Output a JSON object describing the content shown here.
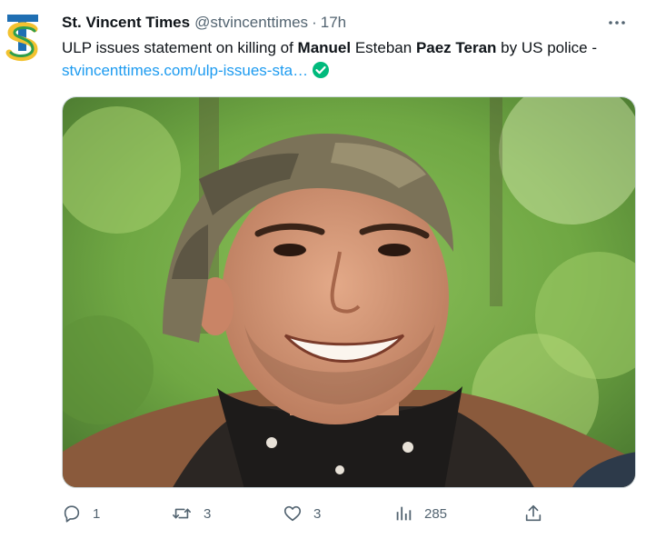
{
  "author": {
    "display_name": "St. Vincent Times",
    "handle": "@stvincenttimes",
    "separator": "·",
    "time": "17h",
    "avatar_letters": "TS"
  },
  "tweet": {
    "text_1": "ULP issues statement on killing of ",
    "text_bold_1": "Manuel",
    "text_2": " Esteban ",
    "text_bold_2": "Paez Teran",
    "text_3": " by US police - ",
    "link": "stvincenttimes.com/ulp-issues-sta…"
  },
  "media": {
    "icon": "photo-of-smiling-man-in-camo-bandana"
  },
  "actions": {
    "replies": "1",
    "retweets": "3",
    "likes": "3",
    "views": "285"
  },
  "colors": {
    "link": "#1d9bf0",
    "secondary": "#536471",
    "verified": "#00ba7c",
    "logo_blue": "#1f6fb3",
    "logo_green": "#2e9e4d",
    "logo_yellow": "#f2c230"
  }
}
